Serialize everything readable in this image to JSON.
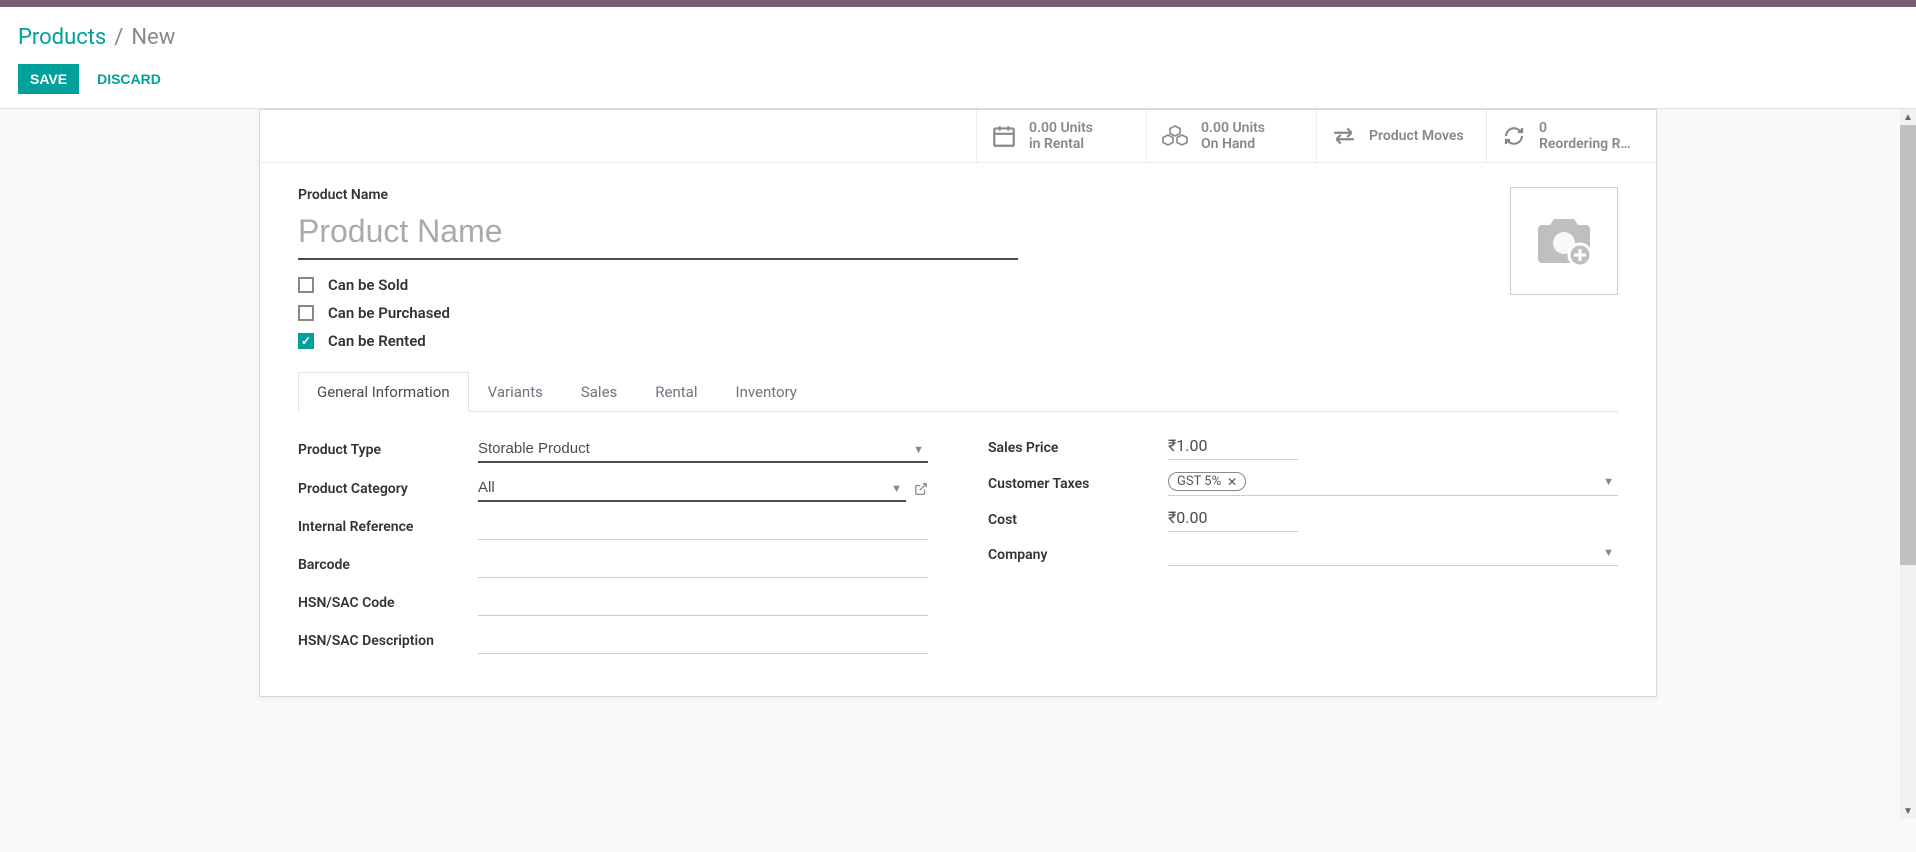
{
  "breadcrumb": {
    "root": "Products",
    "current": "New"
  },
  "actions": {
    "save": "SAVE",
    "discard": "DISCARD"
  },
  "stat_buttons": {
    "rental": {
      "value": "0.00 Units",
      "label": "in Rental"
    },
    "onhand": {
      "value": "0.00 Units",
      "label": "On Hand"
    },
    "moves": {
      "label": "Product Moves"
    },
    "reorder": {
      "value": "0",
      "label": "Reordering R…"
    }
  },
  "product_name": {
    "label": "Product Name",
    "placeholder": "Product Name",
    "value": ""
  },
  "options": {
    "can_be_sold": {
      "label": "Can be Sold",
      "checked": false
    },
    "can_be_purchased": {
      "label": "Can be Purchased",
      "checked": false
    },
    "can_be_rented": {
      "label": "Can be Rented",
      "checked": true
    }
  },
  "tabs": {
    "general": "General Information",
    "variants": "Variants",
    "sales": "Sales",
    "rental": "Rental",
    "inventory": "Inventory"
  },
  "left_fields": {
    "product_type": {
      "label": "Product Type",
      "value": "Storable Product"
    },
    "product_category": {
      "label": "Product Category",
      "value": "All"
    },
    "internal_reference": {
      "label": "Internal Reference",
      "value": ""
    },
    "barcode": {
      "label": "Barcode",
      "value": ""
    },
    "hsn_code": {
      "label": "HSN/SAC Code",
      "value": ""
    },
    "hsn_desc": {
      "label": "HSN/SAC Description",
      "value": ""
    }
  },
  "right_fields": {
    "sales_price": {
      "label": "Sales Price",
      "value": "₹1.00"
    },
    "customer_taxes": {
      "label": "Customer Taxes",
      "tag": "GST 5%"
    },
    "cost": {
      "label": "Cost",
      "value": "₹0.00"
    },
    "company": {
      "label": "Company",
      "value": ""
    }
  }
}
